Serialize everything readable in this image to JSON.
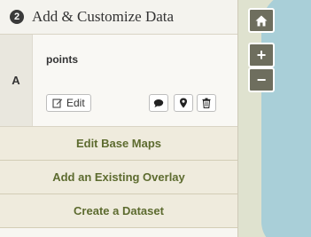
{
  "panel": {
    "step_number": "2",
    "title": "Add & Customize Data"
  },
  "layer": {
    "letter": "A",
    "name": "points",
    "edit_label": "Edit",
    "icons": [
      "comment-icon",
      "map-marker-icon",
      "trash-icon"
    ]
  },
  "actions": {
    "edit_base_maps": "Edit Base Maps",
    "add_overlay": "Add an Existing Overlay",
    "create_dataset": "Create a Dataset"
  },
  "map_controls": {
    "home_icon": "home-icon",
    "zoom_in": "+",
    "zoom_out": "−"
  },
  "colors": {
    "accent_text": "#5d6b2f",
    "map_control_bg": "#6e6e5e",
    "water": "#a9cfd8"
  }
}
